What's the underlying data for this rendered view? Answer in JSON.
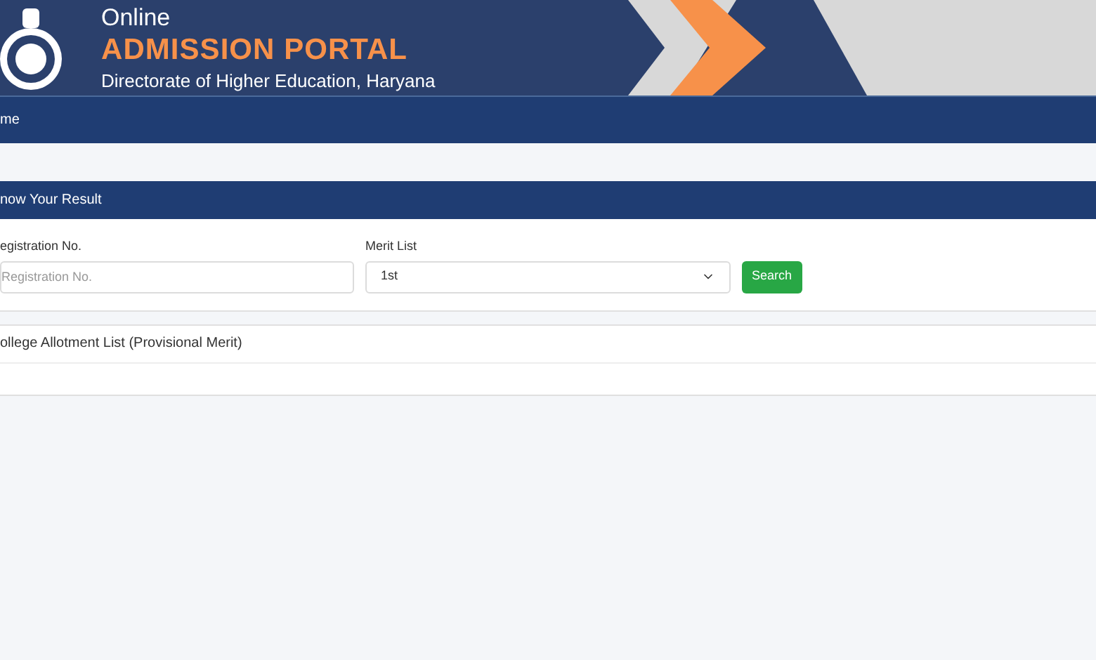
{
  "header": {
    "title_line1": "Online",
    "title_line2": "ADMISSION PORTAL",
    "subtitle": "Directorate of Higher Education, Haryana"
  },
  "nav": {
    "items": [
      {
        "label": "me"
      }
    ]
  },
  "result_panel": {
    "title": "now Your Result",
    "registration": {
      "label": "egistration No.",
      "placeholder": "Registration No."
    },
    "merit_list": {
      "label": "Merit List",
      "value": "1st"
    },
    "search_button": "Search"
  },
  "allotment_panel": {
    "title": "ollege Allotment List (Provisional Merit)"
  }
}
